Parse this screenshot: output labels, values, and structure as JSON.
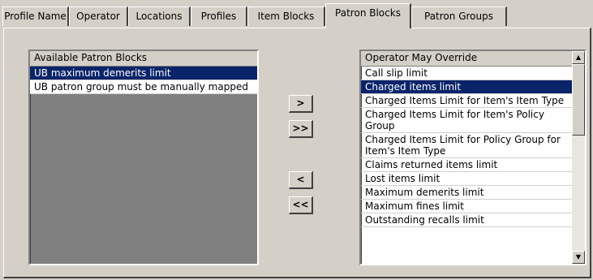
{
  "tabs": [
    {
      "label": "Profile Name"
    },
    {
      "label": "Operator"
    },
    {
      "label": "Locations"
    },
    {
      "label": "Profiles"
    },
    {
      "label": "Item Blocks"
    },
    {
      "label": "Patron Blocks"
    },
    {
      "label": "Patron Groups"
    }
  ],
  "active_tab": "Patron Blocks",
  "available": {
    "header": "Available Patron Blocks",
    "items": [
      {
        "label": "UB maximum demerits limit",
        "selected": true
      },
      {
        "label": "UB patron group must be manually mapped",
        "selected": false
      }
    ]
  },
  "buttons": {
    "add": ">",
    "add_all": ">>",
    "remove": "<",
    "remove_all": "<<"
  },
  "override": {
    "header": "Operator May Override",
    "items": [
      {
        "label": "Call slip limit",
        "selected": false
      },
      {
        "label": "Charged items limit",
        "selected": true
      },
      {
        "label": "Charged Items Limit for Item's Item Type",
        "selected": false
      },
      {
        "label": "Charged Items Limit for Item's Policy Group",
        "selected": false
      },
      {
        "label": "Charged Items Limit for Policy Group for Item's Item Type",
        "selected": false
      },
      {
        "label": "Claims returned items limit",
        "selected": false
      },
      {
        "label": "Lost items limit",
        "selected": false
      },
      {
        "label": "Maximum demerits limit",
        "selected": false
      },
      {
        "label": "Maximum fines limit",
        "selected": false
      },
      {
        "label": "Outstanding recalls limit",
        "selected": false
      }
    ]
  },
  "icons": {
    "scroll_up": "▲",
    "scroll_down": "▼"
  }
}
